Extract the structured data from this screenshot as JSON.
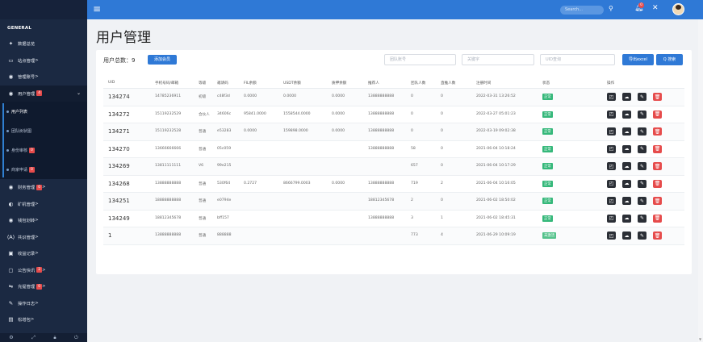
{
  "sidebar": {
    "section": "GENERAL",
    "items": [
      {
        "label": "数据总览",
        "icon": "dashboard-icon",
        "glyph": "✦"
      },
      {
        "label": "站点管理",
        "icon": "monitor-icon",
        "glyph": "▭",
        "suffix": ">"
      },
      {
        "label": "管理账号",
        "icon": "user-icon",
        "glyph": "◉",
        "suffix": ">"
      },
      {
        "label": "用户管理",
        "icon": "user-icon",
        "glyph": "◉",
        "badge": "4"
      }
    ],
    "subitems": [
      {
        "label": "用户列表",
        "badge": ""
      },
      {
        "label": "团队树状图",
        "badge": ""
      },
      {
        "label": "身份审核",
        "badge": "0"
      },
      {
        "label": "商家申请",
        "badge": "0"
      }
    ],
    "items2": [
      {
        "label": "财务管理",
        "icon": "user-icon",
        "glyph": "◉",
        "badge": "0",
        "suffix": ">"
      },
      {
        "label": "矿机管理",
        "icon": "mining-icon",
        "glyph": "◐",
        "suffix": ">"
      },
      {
        "label": "钱包划转",
        "icon": "user-icon",
        "glyph": "◉",
        "suffix": ">"
      },
      {
        "label": "共识管理",
        "icon": "bracket-icon",
        "glyph": "⟨A⟩",
        "suffix": ">"
      },
      {
        "label": "收益记录",
        "icon": "id-card-icon",
        "glyph": "▣",
        "suffix": ">"
      },
      {
        "label": "公告快讯",
        "icon": "window-icon",
        "glyph": "▢",
        "badge": "2",
        "suffix": ">"
      },
      {
        "label": "充提管理",
        "icon": "exchange-icon",
        "glyph": "⇋",
        "badge": "0",
        "suffix": ">"
      },
      {
        "label": "操作日志",
        "icon": "edit-icon",
        "glyph": "✎",
        "suffix": ">"
      },
      {
        "label": "松增包",
        "icon": "package-icon",
        "glyph": "▤",
        "suffix": ">"
      }
    ]
  },
  "topbar": {
    "search_placeholder": "Search...",
    "notification_count": "0"
  },
  "page": {
    "title": "用户管理",
    "summary_label": "用户总数：",
    "summary_count": "9",
    "add_button": "添加会员",
    "team_placeholder": "团队账号",
    "keyword_placeholder": "关键字",
    "uid_placeholder": "UID查询",
    "export_button": "导出excel",
    "search_button": "Q 搜索"
  },
  "table": {
    "headers": [
      "UID",
      "手机号码/邮箱",
      "等级",
      "邀请码",
      "FIL余额",
      "USDT余额",
      "质押余额",
      "推荐人",
      "团队人数",
      "直推人数",
      "注册时间",
      "状态",
      "操作"
    ],
    "rows": [
      {
        "uid": "134274",
        "phone": "14785236911",
        "level": "初级",
        "code": "c48f3d",
        "fil": "0.0000",
        "usdt": "0.0000",
        "pledge": "0.0000",
        "ref": "13888888888",
        "team": "0",
        "direct": "0",
        "time": "2022-03-31 13:26:52",
        "status": "正常",
        "status_color": "#35b87a"
      },
      {
        "uid": "134272",
        "phone": "15119232529",
        "level": "合伙人",
        "code": "34606c",
        "fil": "95841.0000",
        "usdt": "1558544.0000",
        "pledge": "0.0000",
        "ref": "13888888888",
        "team": "0",
        "direct": "0",
        "time": "2022-03-27 05:01:23",
        "status": "正常",
        "status_color": "#35b87a"
      },
      {
        "uid": "134271",
        "phone": "15119232528",
        "level": "普通",
        "code": "e53283",
        "fil": "0.0000",
        "usdt": "159898.0000",
        "pledge": "0.0000",
        "ref": "13888888888",
        "team": "0",
        "direct": "0",
        "time": "2022-03-19 09:02:38",
        "status": "正常",
        "status_color": "#35b87a"
      },
      {
        "uid": "134270",
        "phone": "13666666666",
        "level": "普通",
        "code": "05c059",
        "fil": "",
        "usdt": "",
        "pledge": "",
        "ref": "13888888888",
        "team": "58",
        "direct": "0",
        "time": "2021-06-04 10:18:24",
        "status": "正常",
        "status_color": "#35b87a"
      },
      {
        "uid": "134269",
        "phone": "13811111111",
        "level": "V6",
        "code": "99e215",
        "fil": "",
        "usdt": "",
        "pledge": "",
        "ref": "",
        "team": "657",
        "direct": "0",
        "time": "2021-06-04 10:17:29",
        "status": "正常",
        "status_color": "#35b87a"
      },
      {
        "uid": "134268",
        "phone": "13888888888",
        "level": "普通",
        "code": "530f64",
        "fil": "0.2727",
        "usdt": "8666799.0003",
        "pledge": "0.0000",
        "ref": "13888888888",
        "team": "719",
        "direct": "2",
        "time": "2021-06-04 10:16:05",
        "status": "正常",
        "status_color": "#35b87a"
      },
      {
        "uid": "134251",
        "phone": "18888888888",
        "level": "普通",
        "code": "e0794e",
        "fil": "",
        "usdt": "",
        "pledge": "",
        "ref": "18812345678",
        "team": "2",
        "direct": "0",
        "time": "2021-06-02 18:50:02",
        "status": "正常",
        "status_color": "#35b87a"
      },
      {
        "uid": "134249",
        "phone": "18812345678",
        "level": "普通",
        "code": "bff157",
        "fil": "",
        "usdt": "",
        "pledge": "",
        "ref": "13888888888",
        "team": "3",
        "direct": "1",
        "time": "2021-06-02 18:45:31",
        "status": "正常",
        "status_color": "#35b87a"
      },
      {
        "uid": "1",
        "phone": "13888888888",
        "level": "普通",
        "code": "888888",
        "fil": "",
        "usdt": "",
        "pledge": "",
        "ref": "",
        "team": "773",
        "direct": "4",
        "time": "2021-06-29 10:09:19",
        "status": "未激活",
        "status_color": "#54c28b"
      }
    ]
  }
}
